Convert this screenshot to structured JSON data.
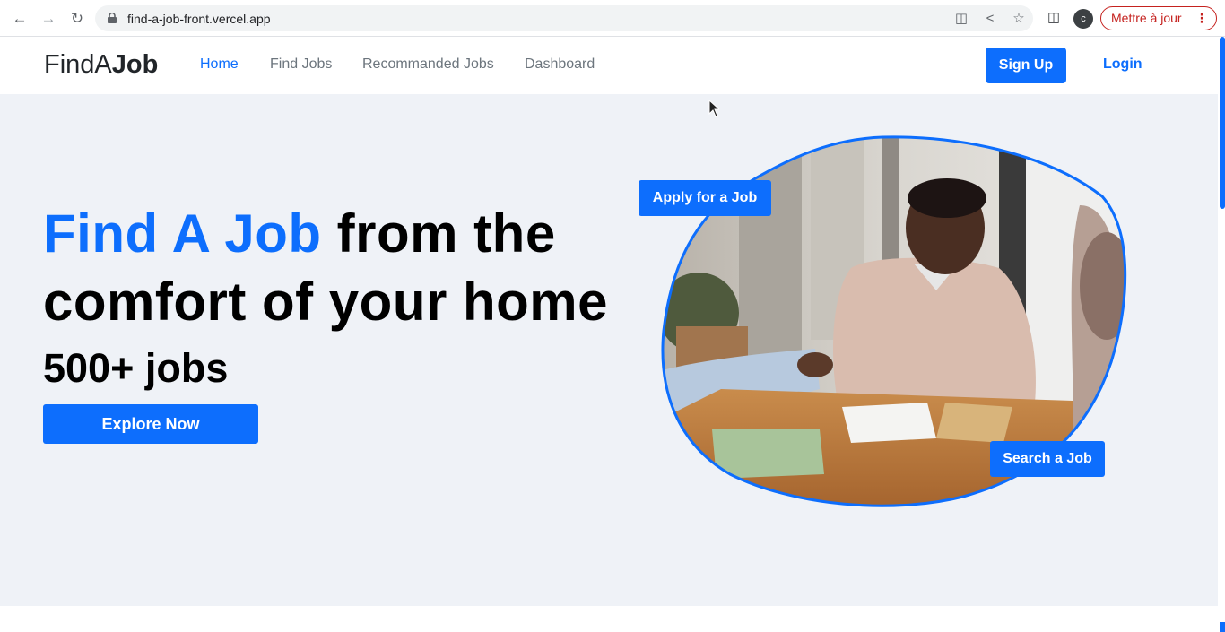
{
  "browser": {
    "url": "find-a-job-front.vercel.app",
    "profile_initial": "c",
    "update_label": "Mettre à jour",
    "icons": [
      "back-icon",
      "forward-icon",
      "reload-icon",
      "lock-icon",
      "translate-icon",
      "share-icon",
      "star-icon",
      "side-panel-icon",
      "more-icon"
    ]
  },
  "navbar": {
    "brand_light": "FindA",
    "brand_bold": "Job",
    "links": [
      {
        "label": "Home",
        "active": true
      },
      {
        "label": "Find Jobs",
        "active": false
      },
      {
        "label": "Recommanded Jobs",
        "active": false
      },
      {
        "label": "Dashboard",
        "active": false
      }
    ],
    "signup_label": "Sign Up",
    "login_label": "Login"
  },
  "hero": {
    "headline_highlight": "Find A Job",
    "headline_rest_1": " from the",
    "headline_rest_2": "comfort of your home",
    "jobs_count": "500+ jobs",
    "explore_label": "Explore Now",
    "apply_label": "Apply for a Job",
    "search_label": "Search a Job",
    "image_alt": "job-interview-handshake-photo"
  },
  "colors": {
    "primary": "#0d6efd",
    "hero_bg": "#eff2f7",
    "update_red": "#c5221f"
  }
}
